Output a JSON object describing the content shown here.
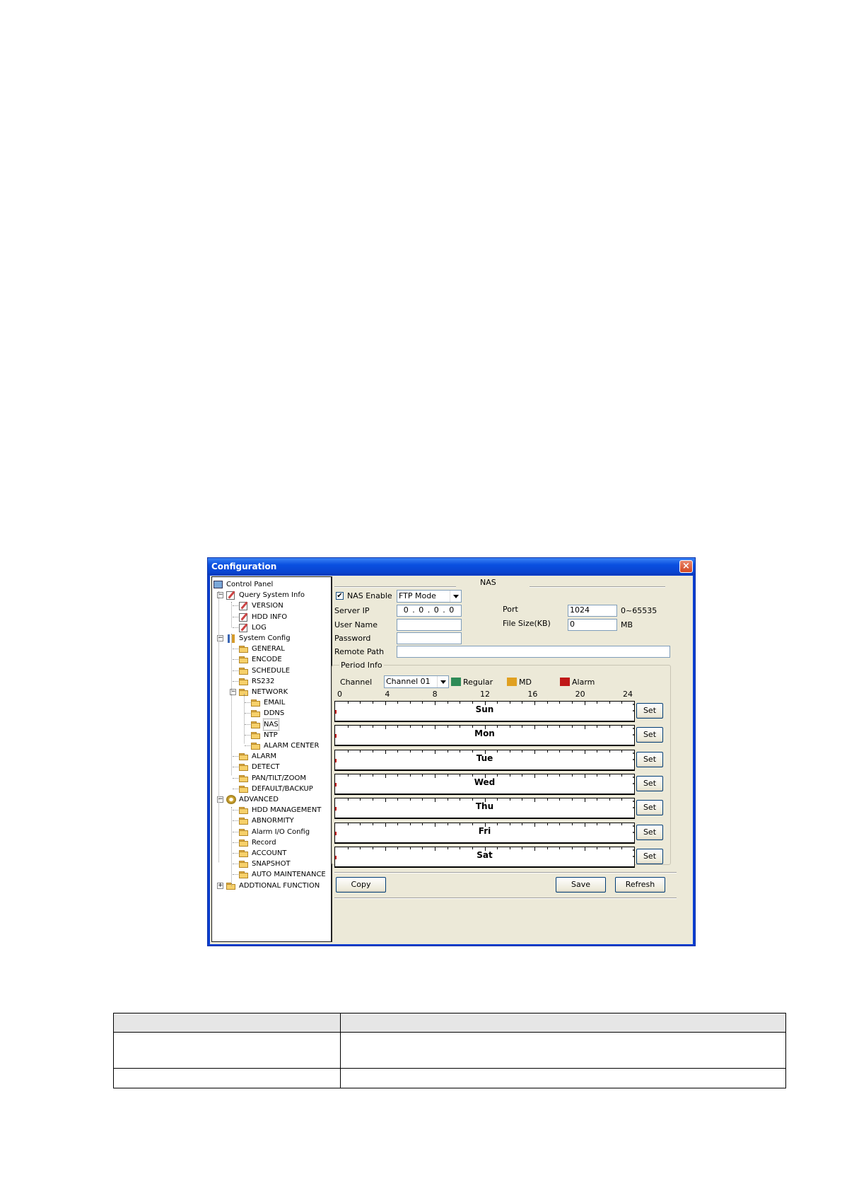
{
  "window": {
    "title": "Configuration",
    "close_glyph": "×"
  },
  "tree": {
    "items": [
      {
        "label": "Control Panel",
        "icon": "computer-icon",
        "level": 0
      },
      {
        "label": "Query System Info",
        "icon": "note-icon",
        "level": 1,
        "expander": "−"
      },
      {
        "label": "VERSION",
        "icon": "note-icon",
        "level": 2
      },
      {
        "label": "HDD INFO",
        "icon": "note-icon",
        "level": 2
      },
      {
        "label": "LOG",
        "icon": "note-icon",
        "level": 2
      },
      {
        "label": "System Config",
        "icon": "tools-icon",
        "level": 1,
        "expander": "−"
      },
      {
        "label": "GENERAL",
        "icon": "folder-icon",
        "level": 2
      },
      {
        "label": "ENCODE",
        "icon": "folder-icon",
        "level": 2
      },
      {
        "label": "SCHEDULE",
        "icon": "folder-icon",
        "level": 2
      },
      {
        "label": "RS232",
        "icon": "folder-icon",
        "level": 2
      },
      {
        "label": "NETWORK",
        "icon": "folder-icon",
        "level": 2,
        "expander": "−"
      },
      {
        "label": "EMAIL",
        "icon": "folder-icon",
        "level": 3
      },
      {
        "label": "DDNS",
        "icon": "folder-icon",
        "level": 3
      },
      {
        "label": "NAS",
        "icon": "folder-open-icon",
        "level": 3,
        "selected": true
      },
      {
        "label": "NTP",
        "icon": "folder-icon",
        "level": 3
      },
      {
        "label": "ALARM CENTER",
        "icon": "folder-icon",
        "level": 3
      },
      {
        "label": "ALARM",
        "icon": "folder-icon",
        "level": 2
      },
      {
        "label": "DETECT",
        "icon": "folder-icon",
        "level": 2
      },
      {
        "label": "PAN/TILT/ZOOM",
        "icon": "folder-icon",
        "level": 2
      },
      {
        "label": "DEFAULT/BACKUP",
        "icon": "folder-icon",
        "level": 2
      },
      {
        "label": "ADVANCED",
        "icon": "gear-icon",
        "level": 1,
        "expander": "−"
      },
      {
        "label": "HDD MANAGEMENT",
        "icon": "folder-icon",
        "level": 2
      },
      {
        "label": "ABNORMITY",
        "icon": "folder-icon",
        "level": 2
      },
      {
        "label": "Alarm I/O Config",
        "icon": "folder-icon",
        "level": 2
      },
      {
        "label": "Record",
        "icon": "folder-icon",
        "level": 2
      },
      {
        "label": "ACCOUNT",
        "icon": "folder-icon",
        "level": 2
      },
      {
        "label": "SNAPSHOT",
        "icon": "folder-icon",
        "level": 2
      },
      {
        "label": "AUTO MAINTENANCE",
        "icon": "folder-icon",
        "level": 2
      },
      {
        "label": "ADDTIONAL FUNCTION",
        "icon": "folder-icon",
        "level": 1,
        "expander": "+"
      }
    ]
  },
  "nas": {
    "section_title": "NAS",
    "enable_label": "NAS Enable",
    "enable_checked": true,
    "check_glyph": "✔",
    "mode_value": "FTP Mode",
    "server_ip_label": "Server IP",
    "server_ip_value": "0 . 0 . 0 . 0",
    "user_name_label": "User Name",
    "user_name_value": "",
    "password_label": "Password",
    "password_value": "",
    "remote_path_label": "Remote Path",
    "remote_path_value": "",
    "port_label": "Port",
    "port_value": "1024",
    "port_range": "0~65535",
    "file_size_label": "File Size(KB)",
    "file_size_value": "0",
    "file_size_unit": "MB"
  },
  "period": {
    "group_title": "Period Info",
    "channel_label": "Channel",
    "channel_value": "Channel 01",
    "legend": [
      {
        "label": "Regular",
        "color": "#2e8b57"
      },
      {
        "label": "MD",
        "color": "#e0a020"
      },
      {
        "label": "Alarm",
        "color": "#c01818"
      }
    ],
    "hour_labels": [
      "0",
      "4",
      "8",
      "12",
      "16",
      "20",
      "24"
    ],
    "days": [
      "Sun",
      "Mon",
      "Tue",
      "Wed",
      "Thu",
      "Fri",
      "Sat"
    ],
    "set_label": "Set"
  },
  "buttons": {
    "copy": "Copy",
    "save": "Save",
    "refresh": "Refresh"
  }
}
